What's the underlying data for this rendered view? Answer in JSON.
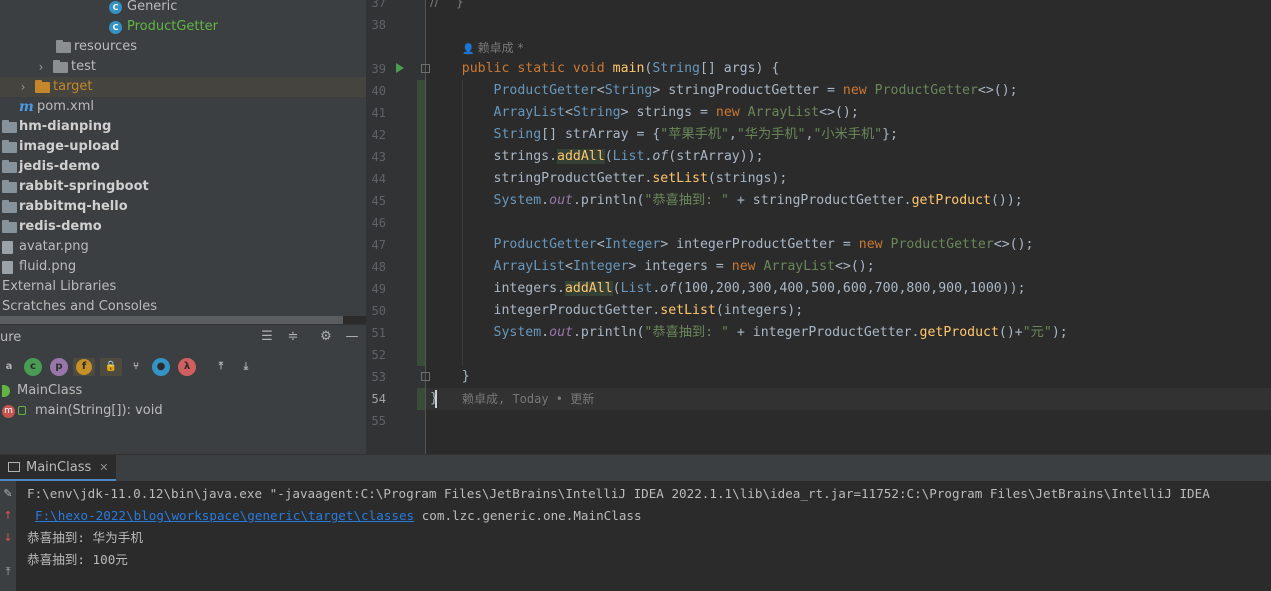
{
  "project_tree": {
    "items": [
      {
        "label": "Generic",
        "kind": "class",
        "indent": 109,
        "partial": true
      },
      {
        "label": "ProductGetter",
        "kind": "class",
        "indent": 109,
        "color": "#62b543"
      },
      {
        "label": "resources",
        "kind": "folder",
        "indent": 56
      },
      {
        "label": "test",
        "kind": "folder",
        "indent": 37,
        "chevron": "›"
      },
      {
        "label": "target",
        "kind": "folder-orange",
        "indent": 19,
        "chevron": "›",
        "selected": true,
        "color": "#c4872c"
      },
      {
        "label": "pom.xml",
        "kind": "maven",
        "indent": 19
      },
      {
        "label": "hm-dianping",
        "kind": "module",
        "indent": 0
      },
      {
        "label": "image-upload",
        "kind": "module",
        "indent": 0
      },
      {
        "label": "jedis-demo",
        "kind": "module",
        "indent": 0
      },
      {
        "label": "rabbit-springboot",
        "kind": "module",
        "indent": 0
      },
      {
        "label": "rabbitmq-hello",
        "kind": "module",
        "indent": 0
      },
      {
        "label": "redis-demo",
        "kind": "module",
        "indent": 0
      },
      {
        "label": "avatar.png",
        "kind": "file",
        "indent": 0
      },
      {
        "label": "fluid.png",
        "kind": "file",
        "indent": 0
      },
      {
        "label": "External Libraries",
        "kind": "none",
        "indent": 0
      },
      {
        "label": "Scratches and Consoles",
        "kind": "none",
        "indent": 0
      }
    ]
  },
  "structure": {
    "title": "ure",
    "class_label": "MainClass",
    "method_label": "main(String[]): void"
  },
  "editor": {
    "author": "赖卓成 *",
    "blame": "赖卓成, Today • 更新",
    "lines": [
      {
        "n": "37",
        "html": "<span class=\"inl\">//    }</span>"
      },
      {
        "n": "38",
        "html": ""
      },
      {
        "n": "",
        "html": ""
      },
      {
        "n": "39",
        "html": "    <span class=\"k\">public static void </span><span class=\"m\">main</span>(<span class=\"t\">String</span>[] args) {"
      },
      {
        "n": "40",
        "html": "        <span class=\"t\">ProductGetter</span>&lt;<span class=\"t\">String</span>&gt; stringProductGetter = <span class=\"k\">new </span><span class=\"s\" style=\"color:#6a8759\">ProductGetter</span>&lt;&gt;();"
      },
      {
        "n": "41",
        "html": "        <span class=\"t\">ArrayList</span>&lt;<span class=\"t\">String</span>&gt; strings = <span class=\"k\">new </span><span class=\"s\">ArrayList</span>&lt;&gt;();"
      },
      {
        "n": "42",
        "html": "        <span class=\"t\">String</span>[] strArray = {<span class=\"s\">\"苹果手机\"</span>,<span class=\"s\">\"华为手机\"</span>,<span class=\"s\">\"小米手机\"</span>};"
      },
      {
        "n": "43",
        "html": "        strings.<span class=\"m\" style=\"background:#344134\">addAll</span>(<span class=\"t\">List</span>.<span class=\"it\">of</span>(strArray));"
      },
      {
        "n": "44",
        "html": "        stringProductGetter.<span class=\"m\">setList</span>(strings);"
      },
      {
        "n": "45",
        "html": "        <span class=\"t\">System</span>.<span class=\"pv\">out</span>.println(<span class=\"s\">\"恭喜抽到: \"</span> + stringProductGetter.<span class=\"m\">getProduct</span>());"
      },
      {
        "n": "46",
        "html": ""
      },
      {
        "n": "47",
        "html": "        <span class=\"t\">ProductGetter</span>&lt;<span class=\"t\">Integer</span>&gt; integerProductGetter = <span class=\"k\">new </span><span class=\"s\">ProductGetter</span>&lt;&gt;();"
      },
      {
        "n": "48",
        "html": "        <span class=\"t\">ArrayList</span>&lt;<span class=\"t\">Integer</span>&gt; integers = <span class=\"k\">new </span><span class=\"s\">ArrayList</span>&lt;&gt;();"
      },
      {
        "n": "49",
        "html": "        integers.<span class=\"m\" style=\"background:#344134\">addAll</span>(<span class=\"t\">List</span>.<span class=\"it\">of</span>(100,200,300,400,500,600,700,800,900,1000));"
      },
      {
        "n": "50",
        "html": "        integerProductGetter.<span class=\"m\">setList</span>(integers);"
      },
      {
        "n": "51",
        "html": "        <span class=\"t\">System</span>.<span class=\"pv\">out</span>.println(<span class=\"s\">\"恭喜抽到: \"</span> + integerProductGetter.<span class=\"m\">getProduct</span>()+<span class=\"s\">\"元\"</span>);"
      },
      {
        "n": "52",
        "html": ""
      },
      {
        "n": "53",
        "html": "    }"
      },
      {
        "n": "54",
        "html": "}"
      },
      {
        "n": "55",
        "html": ""
      }
    ]
  },
  "run": {
    "tab_label": "MainClass",
    "lines": [
      {
        "text": "F:\\env\\jdk-11.0.12\\bin\\java.exe \"-javaagent:C:\\Program Files\\JetBrains\\IntelliJ IDEA 2022.1.1\\lib\\idea_rt.jar=11752:C:\\Program Files\\JetBrains\\IntelliJ IDEA"
      },
      {
        "link": "F:\\hexo-2022\\blog\\workspace\\generic\\target\\classes",
        "text": " com.lzc.generic.one.MainClass"
      },
      {
        "text": "恭喜抽到: 华为手机"
      },
      {
        "text": "恭喜抽到: 100元"
      }
    ]
  },
  "colors": {
    "background": "#2b2b2b",
    "panel": "#3c3f41",
    "keyword": "#cc7832",
    "string": "#6a8759",
    "method": "#ffc66d",
    "type": "#6897bb"
  }
}
